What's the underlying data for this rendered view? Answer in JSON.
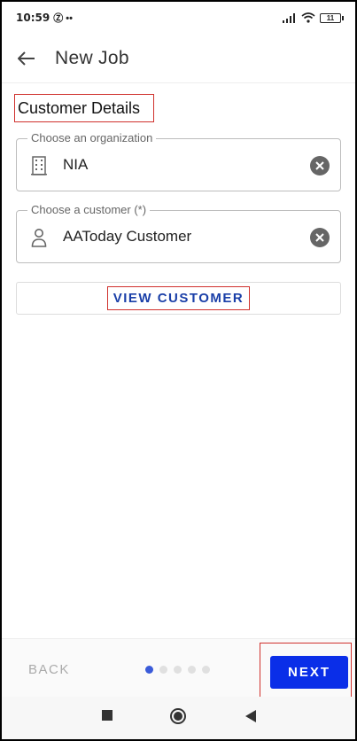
{
  "status_bar": {
    "time": "10:59",
    "left_icons": "Ⓩ ••",
    "battery": "11"
  },
  "app_bar": {
    "title": "New Job"
  },
  "section": {
    "title": "Customer Details"
  },
  "organization_field": {
    "label": "Choose an organization",
    "value": "NIA",
    "icon": "building-icon"
  },
  "customer_field": {
    "label": "Choose a customer (*)",
    "value": "AAToday Customer",
    "icon": "person-icon"
  },
  "view_customer": {
    "label": "VIEW CUSTOMER"
  },
  "stepper": {
    "back_label": "BACK",
    "next_label": "NEXT",
    "total_steps": 5,
    "current_step": 1
  },
  "colors": {
    "accent": "#0a2ee8",
    "link": "#1a3fa8",
    "highlight_box": "#d0312d"
  }
}
